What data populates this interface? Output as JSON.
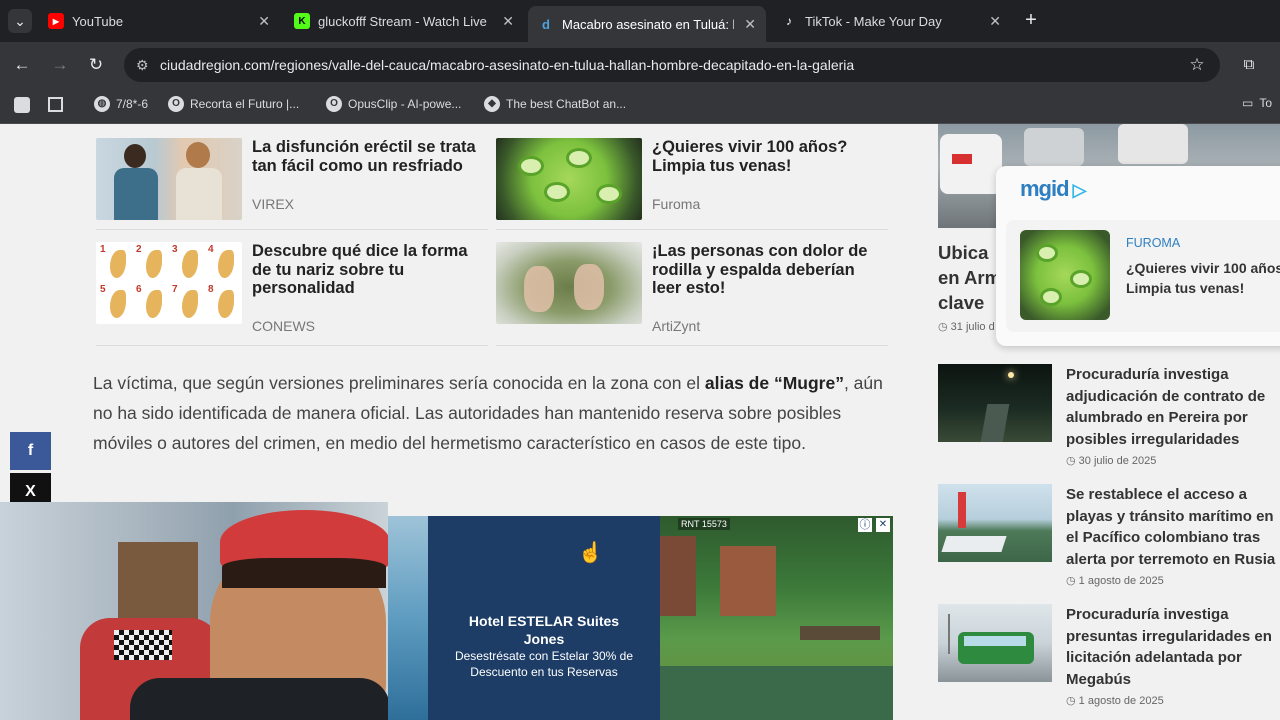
{
  "tabs": [
    {
      "title": "YouTube",
      "close": "✕"
    },
    {
      "title": "gluckofff Stream - Watch Live o",
      "close": "✕"
    },
    {
      "title": "Macabro asesinato en Tuluá: ha",
      "close": "✕"
    },
    {
      "title": "TikTok - Make Your Day",
      "close": "✕"
    }
  ],
  "new_tab": "+",
  "tab_menu": "⌄",
  "address": "ciudadregion.com/regiones/valle-del-cauca/macabro-asesinato-en-tulua-hallan-hombre-decapitado-en-la-galeria",
  "bookmarks": [
    {
      "label": "7/8*-6"
    },
    {
      "label": "Recorta el Futuro |..."
    },
    {
      "label": "OpusClip - AI-powe..."
    },
    {
      "label": "The best ChatBot an..."
    },
    {
      "label": "To"
    }
  ],
  "recommendations": [
    {
      "title": "La disfunción eréctil se trata tan fácil como un resfriado",
      "source": "VIREX"
    },
    {
      "title": "¿Quieres vivir 100 años? Limpia tus venas!",
      "source": "Furoma"
    },
    {
      "title": "Descubre qué dice la forma de tu nariz sobre tu personalidad",
      "source": "CONEWS"
    },
    {
      "title": "¡Las personas con dolor de rodilla y espalda deberían leer esto!",
      "source": "ArtiZynt"
    }
  ],
  "nose_numbers": [
    "1",
    "2",
    "3",
    "4",
    "5",
    "6",
    "7",
    "8"
  ],
  "article": {
    "p_before": "La víctima, que según versiones preliminares sería conocida en la zona con el ",
    "p_bold": "alias de “Mugre”",
    "p_after": ", aún no ha sido identificada de manera oficial. Las autoridades han mantenido reserva sobre posibles móviles o autores del crimen, en medio del hermetismo característico en casos de este tipo."
  },
  "share": {
    "facebook": "f",
    "x": "X"
  },
  "sidebar_top": {
    "title_lines": [
      "Ubica",
      "en Arm",
      "clave"
    ],
    "date": "31 julio d"
  },
  "mgid": {
    "logo": "mgid",
    "source": "FUROMA",
    "title": "¿Quieres vivir 100 años? Limpia tus venas!"
  },
  "sidebar": [
    {
      "title": "Procuraduría investiga adjudicación de contrato de alumbrado en Pereira por posibles irregularidades",
      "date": "30 julio de 2025"
    },
    {
      "title": "Se restablece el acceso a playas y tránsito marítimo en el Pacífico colombiano tras alerta por terremoto en Rusia",
      "date": "1 agosto de 2025"
    },
    {
      "title": "Procuraduría investiga presuntas irregularidades en licitación adelantada por Megabús",
      "date": "1 agosto de 2025"
    }
  ],
  "ad": {
    "rnt": "RNT 15573",
    "title": "Hotel ESTELAR Suites Jones",
    "text": "Desestrésate con Estelar 30% de Descuento en tus Reservas",
    "info": "ⓘ",
    "close": "✕"
  },
  "colors": {
    "chrome": "#202124",
    "toolbar": "#35363a",
    "facebook": "#3b5998",
    "ad_blue": "#1d3d66",
    "mgid_accent": "#2d7fc1"
  }
}
